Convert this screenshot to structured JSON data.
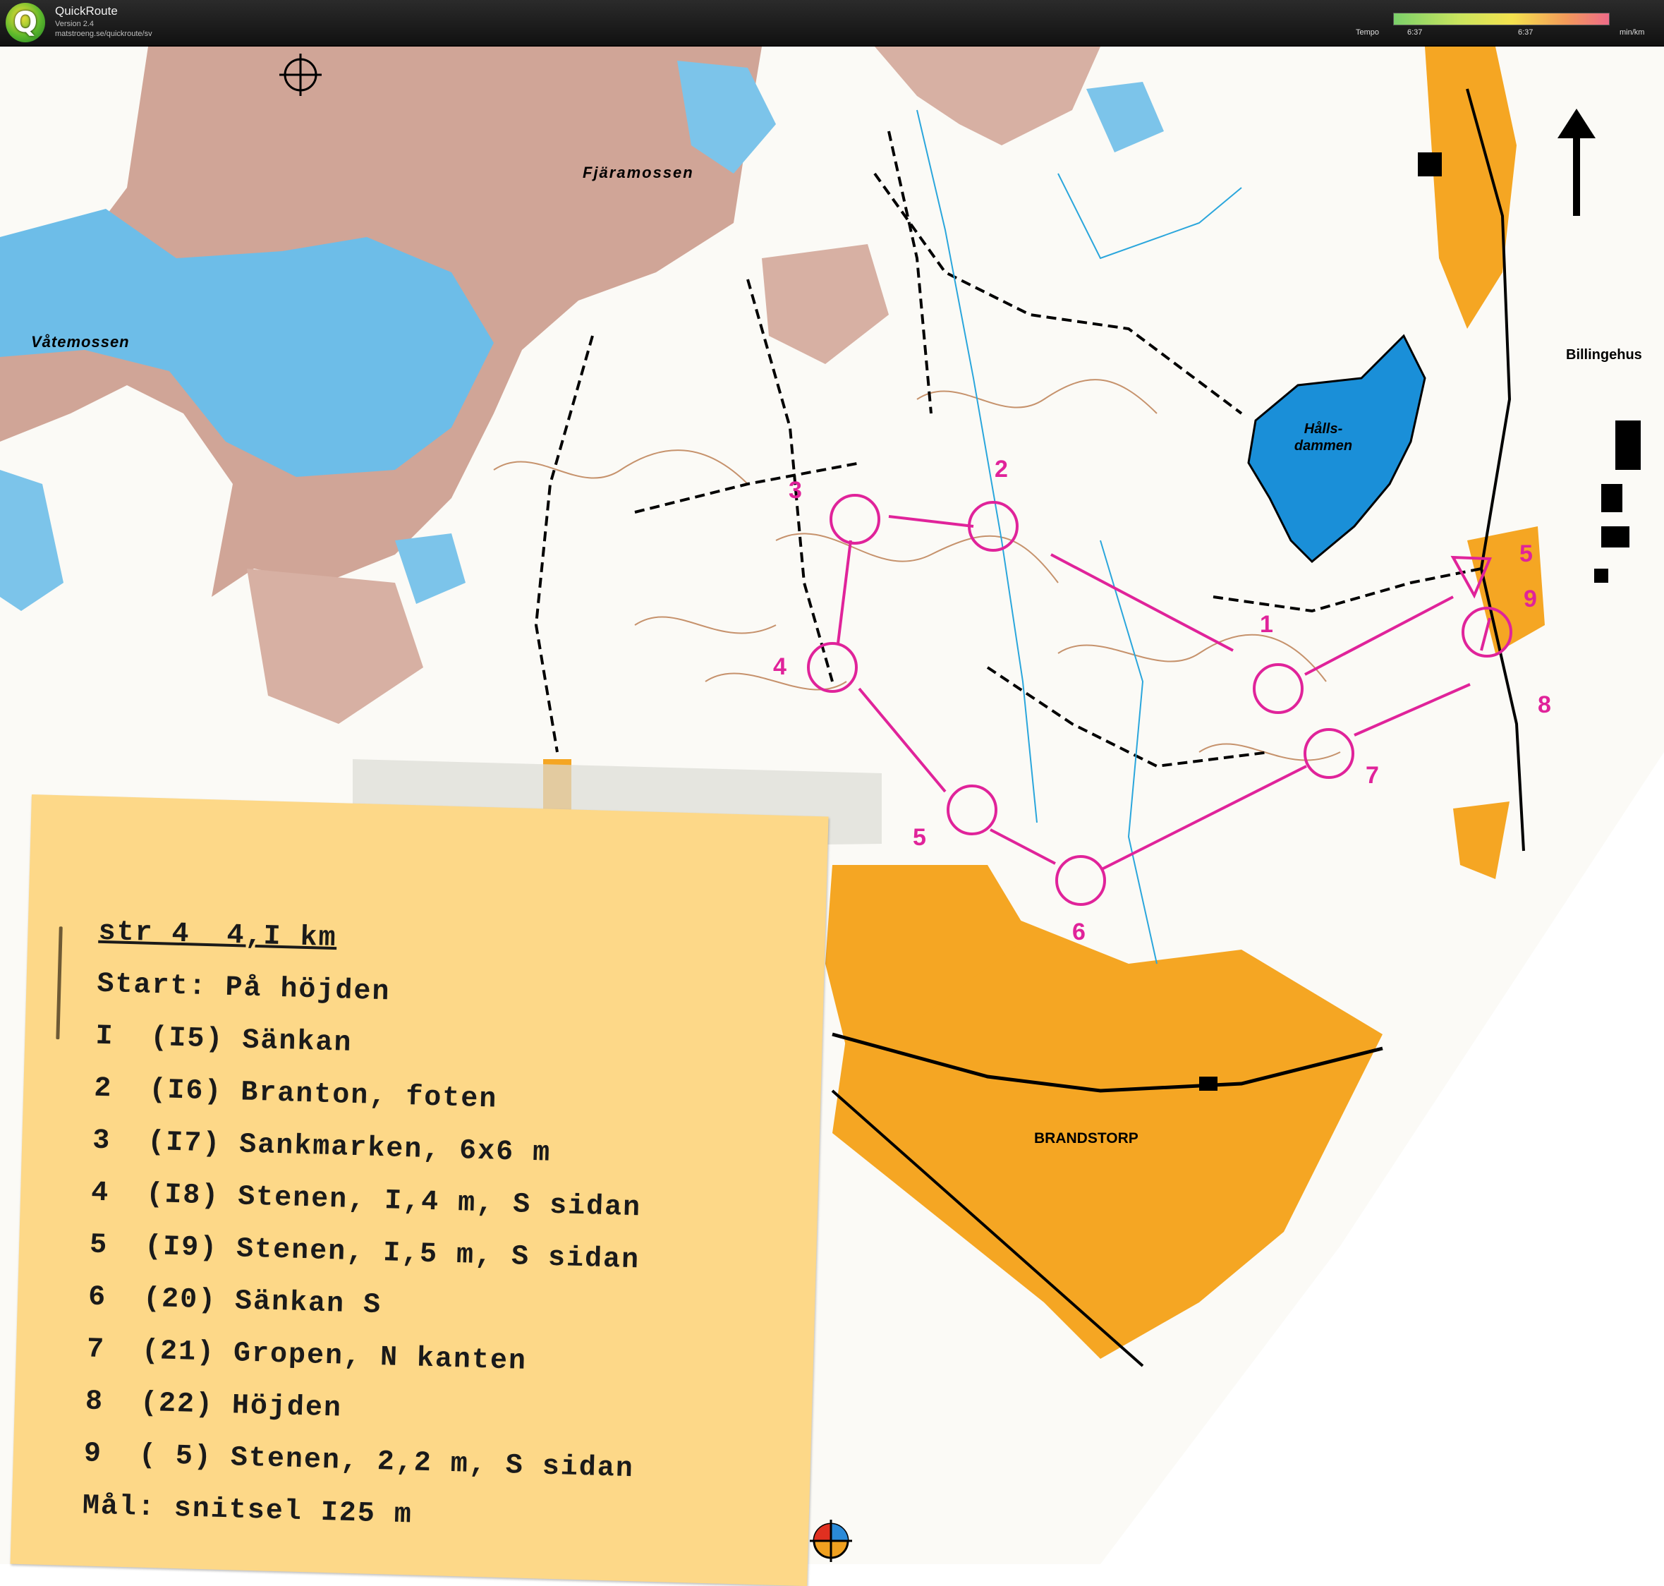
{
  "app": {
    "title": "QuickRoute",
    "version": "Version 2.4",
    "url": "matstroeng.se/quickroute/sv"
  },
  "tempo": {
    "label": "Tempo",
    "min": "6:37",
    "max": "6:37",
    "unit": "min/km",
    "colors": [
      "#7bd06a",
      "#c9e45e",
      "#f4e24e",
      "#f39a5a",
      "#ee6b88"
    ]
  },
  "map": {
    "labels": {
      "fjaramossen": "Fjäramossen",
      "vatemossen": "Våtemossen",
      "hallsdammen_line1": "Hålls-",
      "hallsdammen_line2": "dammen",
      "billingehus": "Billingehus",
      "brandstorp": "BRANDSTORP"
    },
    "controls": [
      "1",
      "2",
      "3",
      "4",
      "5",
      "6",
      "7",
      "8",
      "9"
    ],
    "controls_extra": [
      "5",
      "9"
    ],
    "colors": {
      "course": "#e0239a",
      "marsh": "#cfa596",
      "water": "#5fb8e6",
      "lake": "#1a8fd8",
      "settlement": "#f5a623",
      "contour": "#b9784a"
    }
  },
  "card": {
    "lines": [
      "str 4  4,I km",
      "Start: På höjden",
      "I  (I5) Sänkan",
      "2  (I6) Branton, foten",
      "3  (I7) Sankmarken, 6x6 m",
      "4  (I8) Stenen, I,4 m, S sidan",
      "5  (I9) Stenen, I,5 m, S sidan",
      "6  (20) Sänkan S",
      "7  (21) Gropen, N kanten",
      "8  (22) Höjden",
      "9  ( 5) Stenen, 2,2 m, S sidan",
      "Mål: snitsel I25 m"
    ]
  }
}
